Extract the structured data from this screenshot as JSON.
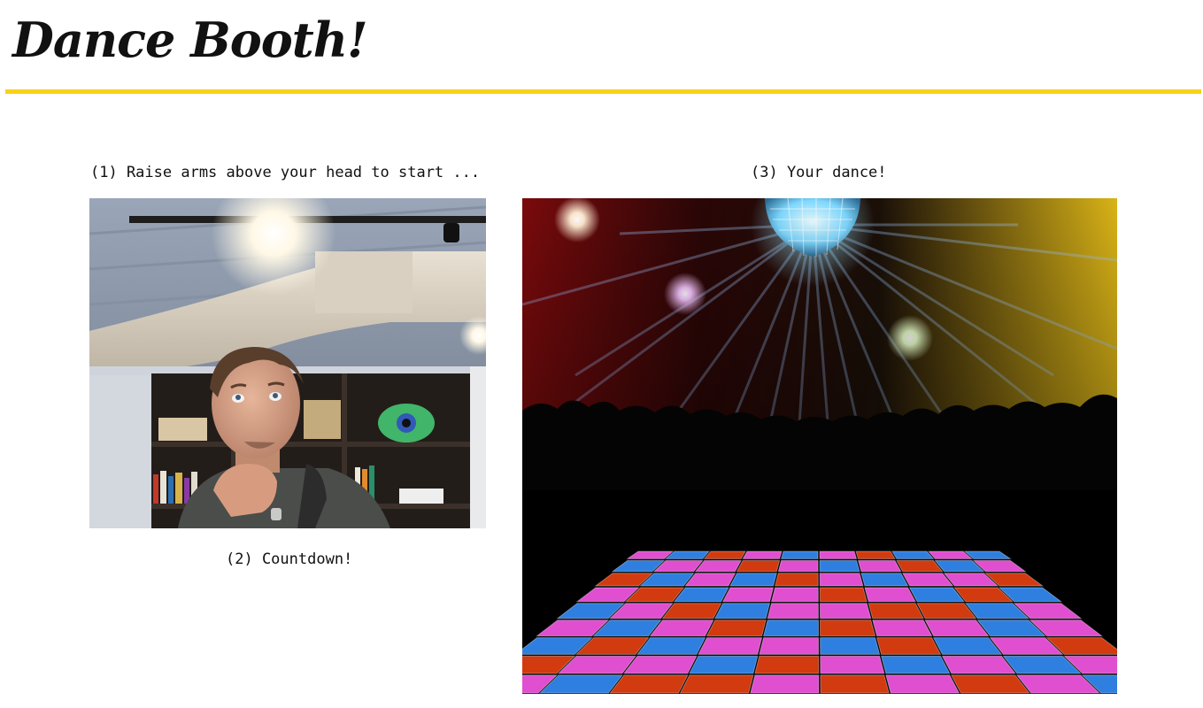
{
  "header": {
    "title": "Dance Booth!",
    "accent_color": "#f7d21a"
  },
  "steps": {
    "step1_label": "(1) Raise arms above your head to start ...",
    "step2_label": "(2) Countdown!",
    "step3_label": "(3) Your dance!"
  },
  "camera": {
    "icon": "webcam-feed"
  },
  "dance_floor": {
    "icon": "disco-ball-scene",
    "tile_colors": [
      "#e04fd0",
      "#2f7fe0",
      "#d23a10"
    ]
  }
}
